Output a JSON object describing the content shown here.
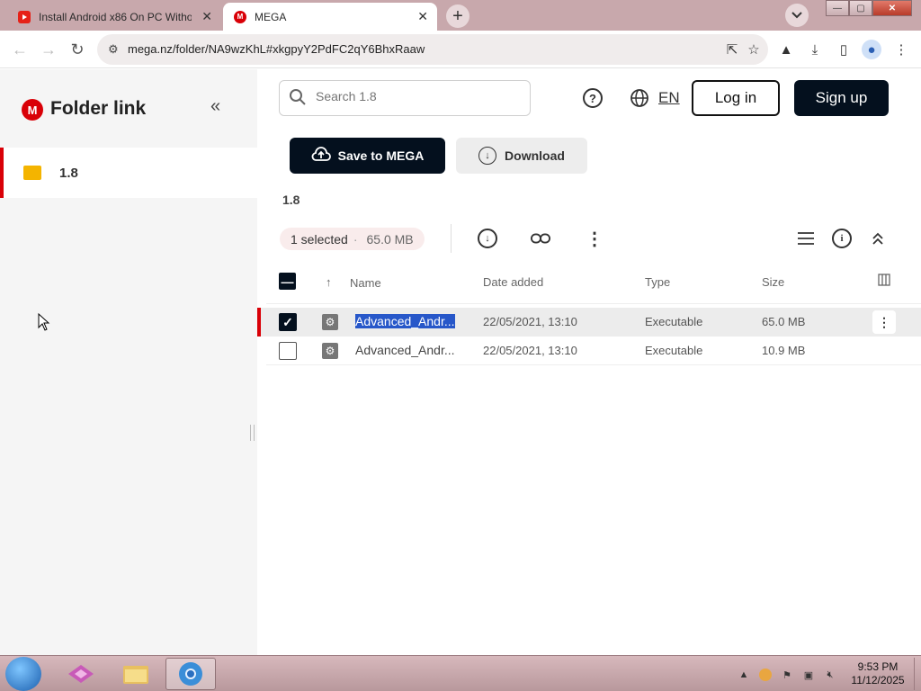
{
  "browser": {
    "tabs": [
      {
        "title": "Install Android x86 On PC Witho",
        "active": false,
        "favicon": "youtube-icon"
      },
      {
        "title": "MEGA",
        "active": true,
        "favicon": "mega-icon"
      }
    ],
    "url": "mega.nz/folder/NA9wzKhL#xkgpyY2PdFC2qY6BhxRaaw"
  },
  "sidebar": {
    "title": "Folder link",
    "items": [
      {
        "label": "1.8",
        "icon": "folder-icon"
      }
    ]
  },
  "header": {
    "search_placeholder": "Search 1.8",
    "language": "EN",
    "login_label": "Log in",
    "signup_label": "Sign up"
  },
  "actions": {
    "save_label": "Save to MEGA",
    "download_label": "Download"
  },
  "breadcrumb": "1.8",
  "selection": {
    "label": "1 selected",
    "separator": "·",
    "size": "65.0 MB"
  },
  "table": {
    "columns": {
      "name": "Name",
      "date": "Date added",
      "type": "Type",
      "size": "Size"
    },
    "rows": [
      {
        "name": "Advanced_Andr...",
        "date": "22/05/2021, 13:10",
        "type": "Executable",
        "size": "65.0 MB",
        "selected": true
      },
      {
        "name": "Advanced_Andr...",
        "date": "22/05/2021, 13:10",
        "type": "Executable",
        "size": "10.9 MB",
        "selected": false
      }
    ]
  },
  "taskbar": {
    "time": "9:53 PM",
    "date": "11/12/2025"
  },
  "colors": {
    "accent_red": "#d90007",
    "dark_button": "#04101e",
    "selection_highlight": "#2757c9",
    "folder": "#f4b400"
  }
}
